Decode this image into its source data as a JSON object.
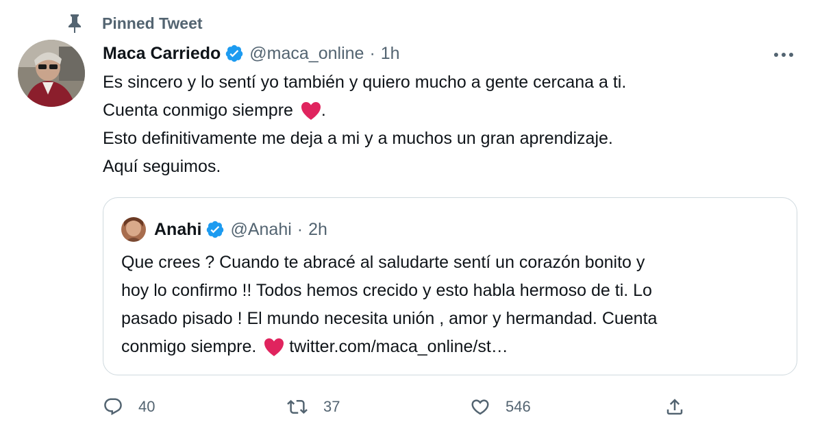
{
  "pinned": {
    "label": "Pinned Tweet",
    "icon": "pin-icon"
  },
  "author": {
    "name": "Maca Carriedo",
    "handle": "@maca_online",
    "separator": "·",
    "time": "1h",
    "verified": true
  },
  "tweet": {
    "lines": [
      "Es sincero y lo sentí yo también y quiero mucho a gente cercana a ti.",
      "Cuenta conmigo siempre",
      "Esto definitivamente me deja a mi y a muchos un gran aprendizaje.",
      "Aquí seguimos."
    ],
    "line2_suffix": "."
  },
  "quote": {
    "name": "Anahi",
    "handle": "@Anahi",
    "separator": "·",
    "time": "2h",
    "lines": [
      "Que crees ? Cuando te abracé al saludarte sentí un corazón bonito y",
      "hoy lo confirmo !! Todos hemos crecido y esto habla hermoso de ti. Lo",
      "pasado pisado !  El mundo necesita unión , amor y hermandad. Cuenta",
      "conmigo siempre."
    ],
    "link": "twitter.com/maca_online/st…"
  },
  "actions": {
    "replies": "40",
    "retweets": "37",
    "likes": "546"
  },
  "colors": {
    "text": "#0f1419",
    "secondary": "#536471",
    "verified": "#1d9bf0",
    "heart": "#e0245e",
    "border": "#cfd9de"
  }
}
